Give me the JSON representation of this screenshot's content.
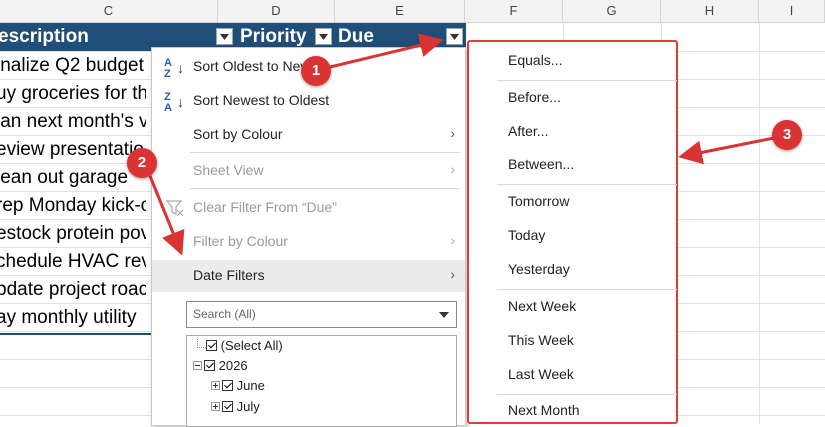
{
  "column_headers": [
    "C",
    "D",
    "E",
    "F",
    "G",
    "H",
    "I"
  ],
  "table": {
    "headers": [
      "escription",
      "Priority",
      "Due"
    ],
    "rows": [
      "inalize Q2 budget",
      "uy groceries for th",
      "lan next month's v",
      "eview presentatio",
      "lean out garage",
      "rep Monday kick-o",
      "estock protein pov",
      "chedule HVAC rev",
      "pdate project roac",
      "ay monthly utility"
    ]
  },
  "filter_menu": {
    "items": [
      {
        "label": "Sort Oldest to Newest",
        "icon": "sort-a-z-icon",
        "enabled": true,
        "submenu": false
      },
      {
        "label": "Sort Newest to Oldest",
        "icon": "sort-z-a-icon",
        "enabled": true,
        "submenu": false
      },
      {
        "label": "Sort by Colour",
        "enabled": true,
        "submenu": true
      },
      {
        "label": "Sheet View",
        "enabled": false,
        "submenu": true
      },
      {
        "label": "Clear Filter From “Due”",
        "icon": "clear-filter-icon",
        "enabled": false,
        "submenu": false
      },
      {
        "label": "Filter by Colour",
        "enabled": false,
        "submenu": true
      },
      {
        "label": "Date Filters",
        "enabled": true,
        "submenu": true,
        "highlighted": true
      }
    ],
    "search_placeholder": "Search (All)",
    "tree": [
      {
        "label": "(Select All)",
        "checked": true
      },
      {
        "label": "2026",
        "checked": true,
        "expander": "minus"
      },
      {
        "label": "June",
        "checked": true,
        "expander": "plus"
      },
      {
        "label": "July",
        "checked": true,
        "expander": "plus"
      }
    ]
  },
  "date_filters_submenu": {
    "items": [
      "Equals...",
      "Before...",
      "After...",
      "Between...",
      "Tomorrow",
      "Today",
      "Yesterday",
      "Next Week",
      "This Week",
      "Last Week",
      "Next Month"
    ]
  },
  "callouts": [
    "1",
    "2",
    "3"
  ],
  "colors": {
    "table_header": "#1f4e79",
    "callout": "#d93333",
    "highlight_border": "#e03b3b"
  }
}
